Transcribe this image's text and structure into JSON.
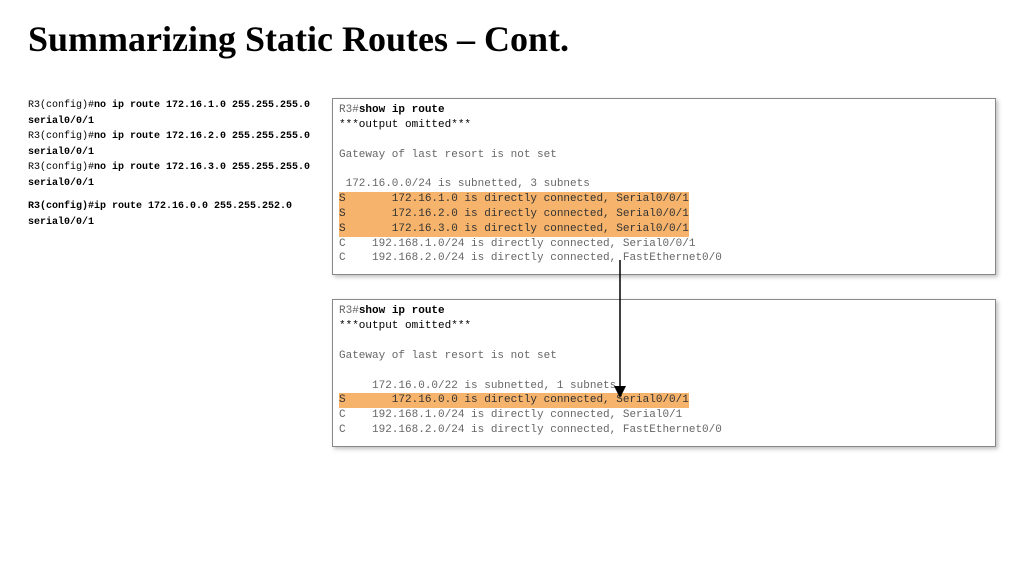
{
  "title": "Summarizing Static Routes – Cont.",
  "left": {
    "l1a": "R3(config)#",
    "l1b": "no ip route 172.16.1.0 255.255.255.0",
    "l2": "serial0/0/1",
    "l3a": "R3(config)#",
    "l3b": "no ip route 172.16.2.0 255.255.255.0",
    "l4": "serial0/0/1",
    "l5a": "R3(config)#",
    "l5b": "no ip route 172.16.3.0 255.255.255.0",
    "l6": "serial0/0/1",
    "l7": "R3(config)#ip route 172.16.0.0 255.255.252.0 serial0/0/1"
  },
  "box1": {
    "prompt": "R3#",
    "cmd": "show ip route",
    "omit": "***output omitted***",
    "gw": "Gateway of last resort is not set",
    "sub": " 172.16.0.0/24 is subnetted, 3 subnets",
    "h1": "S       172.16.1.0 is directly connected, Serial0/0/1",
    "h2": "S       172.16.2.0 is directly connected, Serial0/0/1",
    "h3": "S       172.16.3.0 is directly connected, Serial0/0/1",
    "c1": "C    192.168.1.0/24 is directly connected, Serial0/0/1",
    "c2": "C    192.168.2.0/24 is directly connected, FastEthernet0/0"
  },
  "box2": {
    "prompt": "R3#",
    "cmd": "show ip route",
    "omit": "***output omitted***",
    "gw": "Gateway of last resort is not set",
    "sub": "     172.16.0.0/22 is subnetted, 1 subnets",
    "h1": "S       172.16.0.0 is directly connected, Serial0/0/1",
    "c1": "C    192.168.1.0/24 is directly connected, Serial0/1",
    "c2": "C    192.168.2.0/24 is directly connected, FastEthernet0/0"
  }
}
